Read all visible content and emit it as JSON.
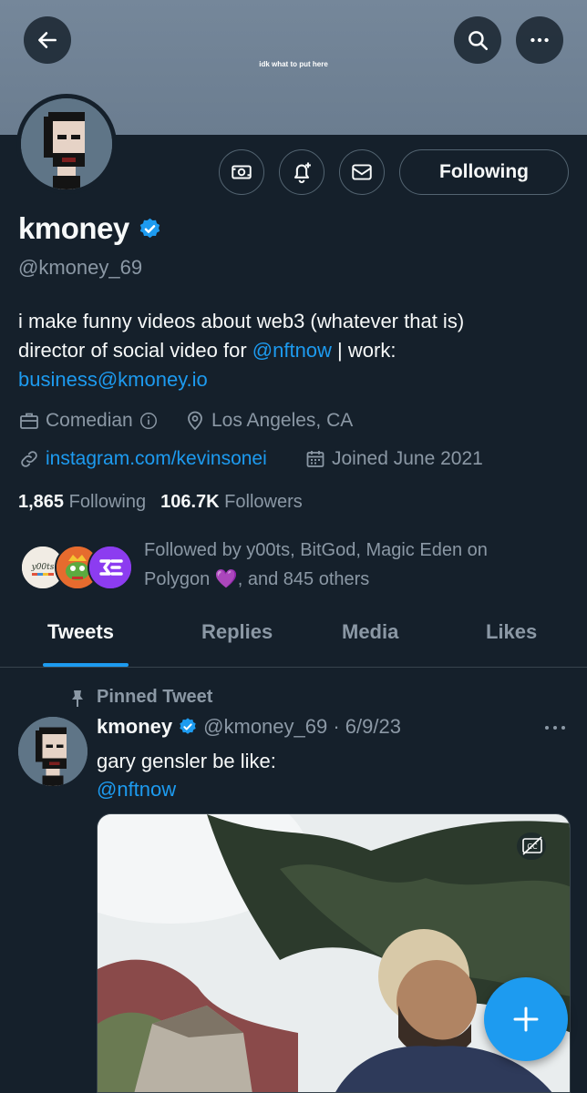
{
  "banner": {
    "caption": "idk what to put here"
  },
  "header": {
    "back_icon": "arrow-left-icon",
    "search_icon": "search-icon",
    "more_icon": "more-horizontal-icon"
  },
  "actions": {
    "icons": [
      "subscribe-money-icon",
      "bell-plus-icon",
      "envelope-icon"
    ],
    "following_label": "Following"
  },
  "profile": {
    "name": "kmoney",
    "handle": "@kmoney_69",
    "bio_line1": "i make funny videos about web3 (whatever that is)",
    "bio_line2_pre": "director of social video for ",
    "bio_mention": "@nftnow",
    "bio_line2_post": " | work:",
    "bio_email": "business@kmoney.io",
    "category": "Comedian",
    "location": "Los Angeles, CA",
    "website": "instagram.com/kevinsonei",
    "joined": "Joined June 2021"
  },
  "stats": {
    "following_count": "1,865",
    "following_label": "Following",
    "followers_count": "106.7K",
    "followers_label": "Followers"
  },
  "followed_by": {
    "line1": "Followed by y00ts, BitGod, Magic Eden on",
    "line2_pre": "Polygon ",
    "emoji": "💜",
    "line2_post": ", and 845 others"
  },
  "tabs": [
    {
      "label": "Tweets",
      "active": true
    },
    {
      "label": "Replies"
    },
    {
      "label": "Media"
    },
    {
      "label": "Likes"
    }
  ],
  "tweet": {
    "pinned_label": "Pinned Tweet",
    "name": "kmoney",
    "handle_date": "@kmoney_69 · 6/9/23",
    "text_line1": "gary gensler be like:",
    "text_mention": "@nftnow"
  },
  "colors": {
    "accent": "#1d9bf0",
    "background": "#15202b",
    "muted": "#8b98a5"
  }
}
